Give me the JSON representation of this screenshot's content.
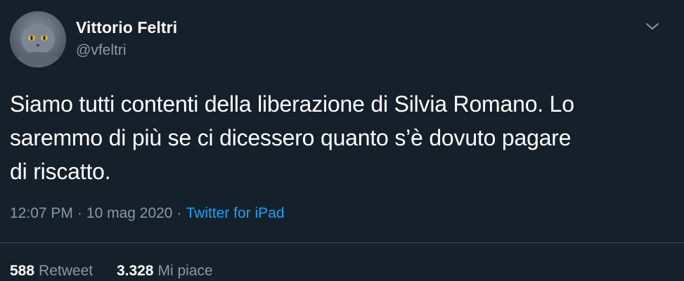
{
  "author": {
    "name": "Vittorio Feltri",
    "handle": "@vfeltri"
  },
  "tweet": {
    "text": "Siamo tutti contenti della liberazione di Silvia Romano. Lo\nsaremmo di più se ci dicessero quanto s’è dovuto pagare\ndi riscatto."
  },
  "meta": {
    "time": "12:07 PM",
    "separator": "·",
    "date": "10 mag 2020",
    "source": "Twitter for iPad"
  },
  "stats": {
    "retweets_count": "588",
    "retweets_label": "Retweet",
    "likes_count": "3.328",
    "likes_label": "Mi piace"
  },
  "icons": {
    "menu": "chevron-down-icon"
  },
  "colors": {
    "background": "#15202b",
    "text": "#ffffff",
    "secondary": "#8899a6",
    "accent": "#1da1f2",
    "divider": "#38444d"
  }
}
